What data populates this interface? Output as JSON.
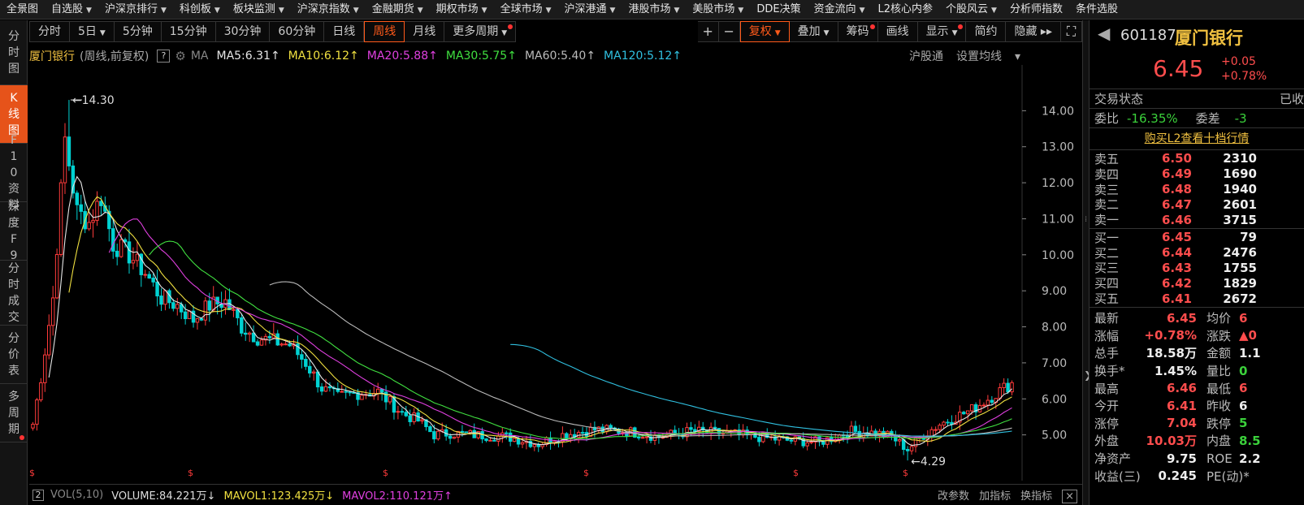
{
  "topmenu": [
    {
      "label": "全景图",
      "caret": false
    },
    {
      "label": "自选股",
      "caret": true
    },
    {
      "label": "沪深京排行",
      "caret": true
    },
    {
      "label": "科创板",
      "caret": true
    },
    {
      "label": "板块监测",
      "caret": true
    },
    {
      "label": "沪深京指数",
      "caret": true
    },
    {
      "label": "金融期货",
      "caret": true
    },
    {
      "label": "期权市场",
      "caret": true
    },
    {
      "label": "全球市场",
      "caret": true
    },
    {
      "label": "沪深港通",
      "caret": true
    },
    {
      "label": "港股市场",
      "caret": true
    },
    {
      "label": "美股市场",
      "caret": true
    },
    {
      "label": "DDE决策",
      "caret": false
    },
    {
      "label": "资金流向",
      "caret": true
    },
    {
      "label": "L2核心内参",
      "caret": false
    },
    {
      "label": "个股风云",
      "caret": true
    },
    {
      "label": "分析师指数",
      "caret": false
    },
    {
      "label": "条件选股",
      "caret": false
    }
  ],
  "lefttabs": [
    {
      "label": "分时图",
      "active": false
    },
    {
      "label": "K线图",
      "active": true
    },
    {
      "label": "F10资料",
      "active": false
    },
    {
      "label": "深度F9",
      "active": false
    },
    {
      "label": "分时成交",
      "active": false
    },
    {
      "label": "分价表",
      "active": false
    },
    {
      "label": "多周期",
      "active": false
    }
  ],
  "toolbar": {
    "periods": [
      "分时",
      "5日",
      "5分钟",
      "15分钟",
      "30分钟",
      "60分钟",
      "日线",
      "周线",
      "月线",
      "更多周期"
    ],
    "active_period": "周线",
    "zoom_in": "+",
    "zoom_out": "−",
    "right": [
      "复权",
      "叠加",
      "筹码",
      "画线",
      "显示",
      "简约",
      "隐藏"
    ],
    "fullscreen": "⛶"
  },
  "legend": {
    "stock": "厦门银行",
    "sub": "(周线,前复权)",
    "help": "?",
    "ma_label": "MA",
    "ma": [
      {
        "text": "MA5:6.31",
        "color": "#e6e6e6"
      },
      {
        "text": "MA10:6.12",
        "color": "#f0e040"
      },
      {
        "text": "MA20:5.88",
        "color": "#e040e0"
      },
      {
        "text": "MA30:5.75",
        "color": "#40e040"
      },
      {
        "text": "MA60:5.40",
        "color": "#bbbbbb"
      },
      {
        "text": "MA120:5.12",
        "color": "#30c0e0"
      }
    ],
    "ma_arrow": "↑",
    "right_links": [
      "沪股通",
      "设置均线"
    ]
  },
  "chart_data": {
    "type": "candlestick",
    "title": "厦门银行",
    "ylim": [
      4.0,
      15.0
    ],
    "yticks": [
      5.0,
      6.0,
      7.0,
      8.0,
      9.0,
      10.0,
      11.0,
      12.0,
      13.0,
      14.0
    ],
    "annotations": [
      {
        "label": "14.30",
        "value": 14.3,
        "kind": "high"
      },
      {
        "label": "4.29",
        "value": 4.29,
        "kind": "low"
      }
    ],
    "last_close": 6.45,
    "series": [
      {
        "name": "MA5",
        "value": 6.31,
        "color": "#e6e6e6"
      },
      {
        "name": "MA10",
        "value": 6.12,
        "color": "#f0e040"
      },
      {
        "name": "MA20",
        "value": 5.88,
        "color": "#e040e0"
      },
      {
        "name": "MA30",
        "value": 5.75,
        "color": "#40e040"
      },
      {
        "name": "MA60",
        "value": 5.4,
        "color": "#bbbbbb"
      },
      {
        "name": "MA120",
        "value": 5.12,
        "color": "#30c0e0"
      }
    ],
    "grid": false,
    "up_color": "#ff3b3b",
    "down_color": "#00d2d2"
  },
  "volbar": {
    "toggle": "2",
    "label": "VOL(5,10)",
    "volume": "VOLUME:84.221万↓",
    "mavol1": "MAVOL1:123.425万↓",
    "mavol2": "MAVOL2:110.121万↑",
    "right": [
      "改参数",
      "加指标",
      "换指标"
    ],
    "close": "×"
  },
  "quote": {
    "code": "601187",
    "name": "厦门银行",
    "price": "6.45",
    "change": "+0.05",
    "change_pct": "+0.78%",
    "trade_status_label": "交易状态",
    "trade_status_value": "已收",
    "weibi_label": "委比",
    "weibi_value": "-16.35%",
    "weicha_label": "委差",
    "weicha_value": "-3",
    "l2_link": "购买L2查看十档行情",
    "asks": [
      {
        "label": "卖五",
        "price": "6.50",
        "vol": "2310"
      },
      {
        "label": "卖四",
        "price": "6.49",
        "vol": "1690"
      },
      {
        "label": "卖三",
        "price": "6.48",
        "vol": "1940"
      },
      {
        "label": "卖二",
        "price": "6.47",
        "vol": "2601"
      },
      {
        "label": "卖一",
        "price": "6.46",
        "vol": "3715"
      }
    ],
    "bids": [
      {
        "label": "买一",
        "price": "6.45",
        "vol": "79"
      },
      {
        "label": "买二",
        "price": "6.44",
        "vol": "2476"
      },
      {
        "label": "买三",
        "price": "6.43",
        "vol": "1755"
      },
      {
        "label": "买四",
        "price": "6.42",
        "vol": "1829"
      },
      {
        "label": "买五",
        "price": "6.41",
        "vol": "2672"
      }
    ],
    "stats": [
      {
        "k1": "最新",
        "v1": "6.45",
        "c1": "red",
        "k2": "均价",
        "v2": "6",
        "c2": "red"
      },
      {
        "k1": "涨幅",
        "v1": "+0.78%",
        "c1": "red",
        "k2": "涨跌",
        "v2": "▲0",
        "c2": "red"
      },
      {
        "k1": "总手",
        "v1": "18.58万",
        "c1": "wht",
        "k2": "金额",
        "v2": "1.1",
        "c2": "wht"
      },
      {
        "k1": "换手*",
        "v1": "1.45%",
        "c1": "wht",
        "k2": "量比",
        "v2": "0",
        "c2": "grn"
      },
      {
        "k1": "最高",
        "v1": "6.46",
        "c1": "red",
        "k2": "最低",
        "v2": "6",
        "c2": "red"
      },
      {
        "k1": "今开",
        "v1": "6.41",
        "c1": "red",
        "k2": "昨收",
        "v2": "6",
        "c2": "wht"
      },
      {
        "k1": "涨停",
        "v1": "7.04",
        "c1": "red",
        "k2": "跌停",
        "v2": "5",
        "c2": "grn"
      },
      {
        "k1": "外盘",
        "v1": "10.03万",
        "c1": "red",
        "k2": "内盘",
        "v2": "8.5",
        "c2": "grn"
      },
      {
        "k1": "净资产",
        "v1": "9.75",
        "c1": "wht",
        "k2": "ROE",
        "v2": "2.2",
        "c2": "wht"
      },
      {
        "k1": "收益(三)",
        "v1": "0.245",
        "c1": "wht",
        "k2": "PE(动)*",
        "v2": "",
        "c2": "wht"
      }
    ]
  }
}
